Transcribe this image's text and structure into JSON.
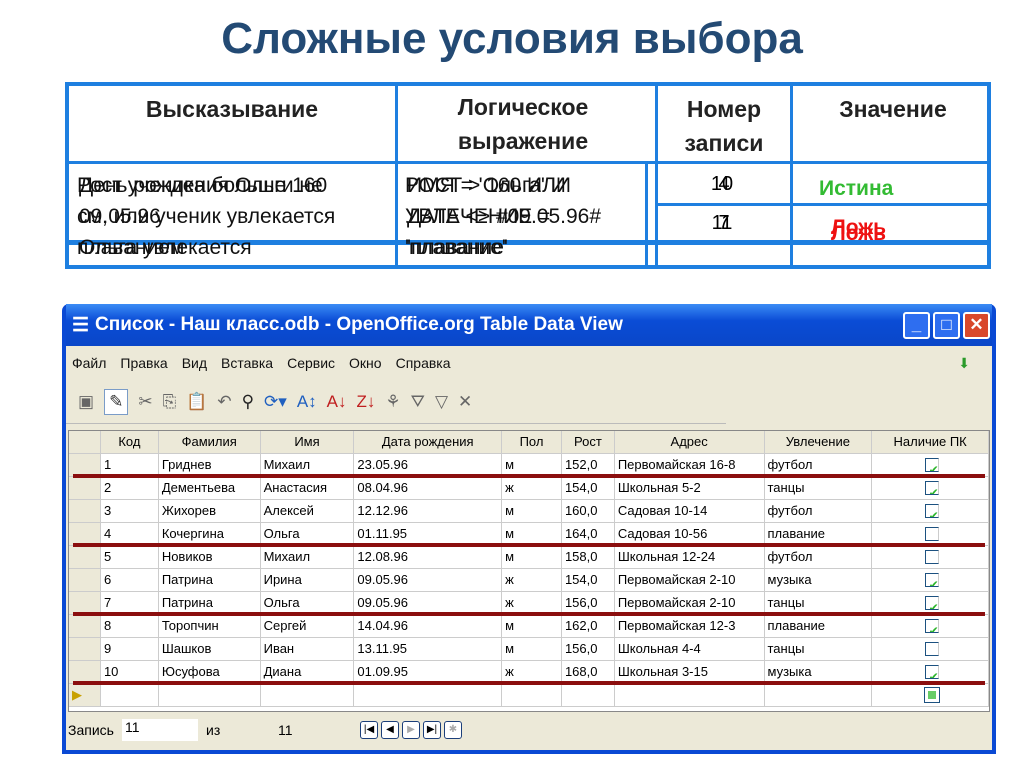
{
  "title": "Сложные условия выбора",
  "table": {
    "headers": [
      "Высказывание",
      "Логическое выражение",
      "Номер записи",
      "Значение"
    ],
    "layer_a": {
      "statement": [
        "Рост ученика больше 160",
        "см, или ученик увлекается",
        "плаванием"
      ],
      "expression": [
        "РОСТ > 160 ИЛИ",
        "УВЛЕЧЕНИЕ = ",
        "'плавание'"
      ],
      "numbers": [
        "10",
        "11"
      ],
      "values": [
        "Истина",
        "Ложь"
      ]
    },
    "layer_b": {
      "statement": [
        "День рождения Ольги не",
        "09.05.96",
        "Ольга увлекается"
      ],
      "expression": [
        "ИМЯ = 'Ольга' И",
        "ДАТА <> #09.05.96#",
        "'плавание'"
      ],
      "numbers": [
        "4",
        "7"
      ],
      "values": [
        "",
        "Ложь"
      ]
    }
  },
  "colors": {
    "true": "#33bb33",
    "false": "#ee1111",
    "border": "#1e7fe0"
  },
  "window": {
    "title": "Список - Наш класс.odb - OpenOffice.org Table Data View",
    "menu": [
      "Файл",
      "Правка",
      "Вид",
      "Вставка",
      "Сервис",
      "Окно",
      "Справка"
    ],
    "columns": [
      "Код",
      "Фамилия",
      "Имя",
      "Дата рождения",
      "Пол",
      "Рост",
      "Адрес",
      "Увлечение",
      "Наличие ПК"
    ],
    "rows": [
      [
        "1",
        "Гриднев",
        "Михаил",
        "23.05.96",
        "м",
        "152,0",
        "Первомайская 16-8",
        "футбол",
        true
      ],
      [
        "2",
        "Дементьева",
        "Анастасия",
        "08.04.96",
        "ж",
        "154,0",
        "Школьная 5-2",
        "танцы",
        true
      ],
      [
        "3",
        "Жихорев",
        "Алексей",
        "12.12.96",
        "м",
        "160,0",
        "Садовая 10-14",
        "футбол",
        true
      ],
      [
        "4",
        "Кочергина",
        "Ольга",
        "01.11.95",
        "м",
        "164,0",
        "Садовая 10-56",
        "плавание",
        false
      ],
      [
        "5",
        "Новиков",
        "Михаил",
        "12.08.96",
        "м",
        "158,0",
        "Школьная 12-24",
        "футбол",
        false
      ],
      [
        "6",
        "Патрина",
        "Ирина",
        "09.05.96",
        "ж",
        "154,0",
        "Первомайская 2-10",
        "музыка",
        true
      ],
      [
        "7",
        "Патрина",
        "Ольга",
        "09.05.96",
        "ж",
        "156,0",
        "Первомайская 2-10",
        "танцы",
        true
      ],
      [
        "8",
        "Торопчин",
        "Сергей",
        "14.04.96",
        "м",
        "162,0",
        "Первомайская 12-3",
        "плавание",
        true
      ],
      [
        "9",
        "Шашков",
        "Иван",
        "13.11.95",
        "м",
        "156,0",
        "Школьная 4-4",
        "танцы",
        false
      ],
      [
        "10",
        "Юсуфова",
        "Диана",
        "01.09.95",
        "ж",
        "168,0",
        "Школьная 3-15",
        "музыка",
        true
      ]
    ],
    "highlighted_rows": [
      "1",
      "4",
      "7",
      "10"
    ],
    "status": {
      "label": "Запись",
      "current": "11",
      "of": "из",
      "total": "11"
    }
  }
}
